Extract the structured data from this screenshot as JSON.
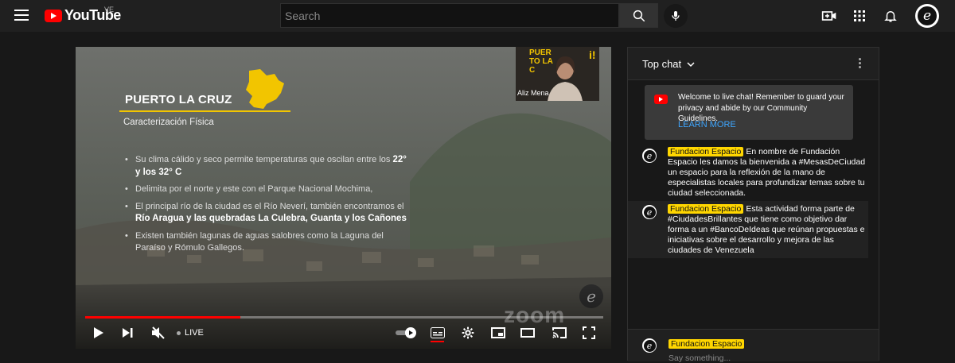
{
  "header": {
    "logo_text": "YouTube",
    "country_code": "VE",
    "search_placeholder": "Search",
    "icons": [
      "menu-icon",
      "search-icon",
      "mic-icon",
      "create-icon",
      "apps-icon",
      "bell-icon",
      "avatar"
    ],
    "brand_color": "#ff0000"
  },
  "slide": {
    "title": "PUERTO LA CRUZ",
    "subtitle": "Caracterización Física",
    "bullets": [
      {
        "text": "Su clima cálido y seco permite temperaturas que oscilan entre los",
        "strong": "22° y los 32° C"
      },
      {
        "text": "Delimita por el norte y este con el Parque Nacional Mochima,",
        "strong": ""
      },
      {
        "text": "El principal río de la ciudad es el Río Neverí, también encontramos el",
        "strong": "Río Aragua y las quebradas La Culebra, Guanta y los Cañones"
      },
      {
        "text": "Existen también lagunas de aguas salobres como la Laguna del Paraíso y Rómulo Gallegos.",
        "strong": ""
      }
    ],
    "pip_word": "PUER TO LA C",
    "pip_bang": "i!",
    "pip_name": "Aliz Mena",
    "seal_letter": "e",
    "watermark": "zoom",
    "accent_color": "#f2c500"
  },
  "player": {
    "progress": 0.3,
    "live_label": "LIVE",
    "controls": [
      "play-icon",
      "next-icon",
      "mute-icon",
      "autoplay-toggle",
      "captions-icon",
      "settings-icon",
      "miniplayer-icon",
      "theater-icon",
      "cast-icon",
      "fullscreen-icon"
    ]
  },
  "chat": {
    "title": "Top chat",
    "welcome_text": "Welcome to live chat! Remember to guard your privacy and abide by our Community Guidelines.",
    "welcome_link": "LEARN MORE",
    "messages": [
      {
        "author": "Fundacion Espacio",
        "text": "En nombre de Fundación Espacio les damos la bienvenida a #MesasDeCiudad un espacio para la reflexión de la mano de especialistas locales para profundizar temas sobre tu ciudad seleccionada."
      },
      {
        "author": "Fundacion Espacio",
        "text": "Esta actividad forma parte de #CiudadesBrillantes que tiene como objetivo dar forma a un #BancoDeIdeas que reúnan propuestas e iniciativas sobre el desarrollo y mejora de las ciudades de Venezuela"
      }
    ],
    "footer_author": "Fundacion Espacio",
    "footer_placeholder": "Say something..."
  }
}
